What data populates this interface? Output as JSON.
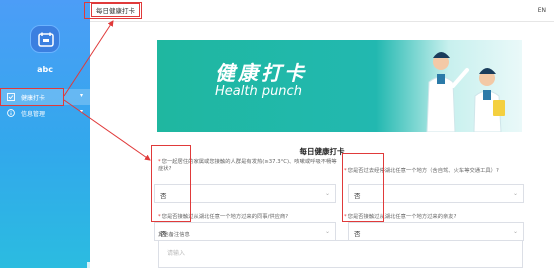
{
  "sidebar": {
    "username": "abc",
    "items": [
      {
        "label": "健康打卡",
        "icon": "checkin-icon",
        "arrow": "▾",
        "active": true
      },
      {
        "label": "信息管理",
        "icon": "info-icon",
        "arrow": "▾",
        "active": false
      }
    ]
  },
  "topbar": {
    "tab_label": "每日健康打卡",
    "lang": "EN"
  },
  "banner": {
    "title": "健康打卡",
    "subtitle": "Health punch"
  },
  "form": {
    "title": "每日健康打卡",
    "questions": [
      {
        "label": "您一起居住的家属或您接触的人群是有发热(≥37.3°C)、咳嗽或呼吸不畅等症状?",
        "value": "否"
      },
      {
        "label": "您是否过去经停湖北任意一个地方（含自驾、火车等交通工具）?",
        "value": "否"
      },
      {
        "label": "您是否接触过从湖北任意一个地方过来的同事/供应商?",
        "value": "否"
      },
      {
        "label": "您是否接触过从湖北任意一个地方过来的亲友?",
        "value": "否"
      }
    ],
    "remark_label": "其他备注信息",
    "remark_placeholder": "请输入"
  },
  "colors": {
    "sidebar_top": "#4c9df7",
    "sidebar_bottom": "#2bbce0",
    "banner": "#1fb7a0",
    "highlight": "#e03a3a"
  }
}
